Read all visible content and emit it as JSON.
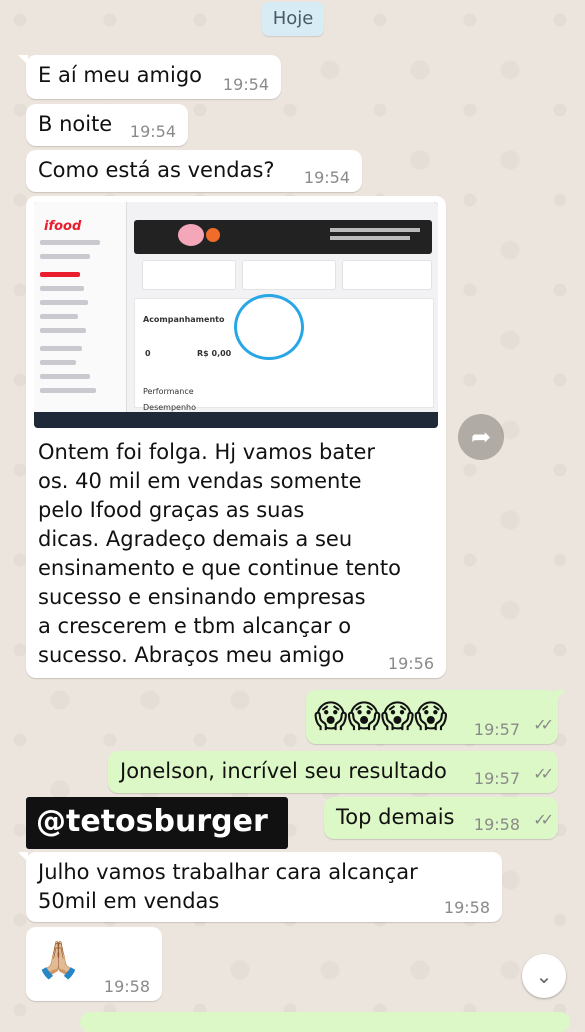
{
  "date_label": "Hoje",
  "messages": [
    {
      "text": "E aí meu amigo",
      "time": "19:54"
    },
    {
      "text": "B noite",
      "time": "19:54"
    },
    {
      "text": "Como está as vendas?",
      "time": "19:54"
    },
    {
      "photo": {
        "brand": "ifood",
        "banner": "Repasse semanal com taxa reduzida ativo!",
        "section": "Acompanhamento",
        "values": [
          "0",
          "R$ 0,00"
        ],
        "rows": [
          "Performance",
          "Desempenho"
        ]
      },
      "caption_lines": [
        "Ontem foi folga. Hj vamos bater",
        "os. 40 mil em vendas somente",
        "pelo Ifood graças as suas",
        "dicas. Agradeço demais a seu",
        "ensinamento e que continue tento",
        "sucesso e ensinando empresas",
        "a crescerem e tbm alcançar o",
        "sucesso. Abraços meu amigo"
      ],
      "time": "19:56"
    },
    {
      "text": "😱😱😱😱",
      "time": "19:57",
      "ticks": "✓✓"
    },
    {
      "text": "Jonelson, incrível seu resultado",
      "time": "19:57",
      "ticks": "✓✓"
    },
    {
      "text": "Top demais",
      "time": "19:58",
      "ticks": "✓✓"
    },
    {
      "lines": [
        "Julho vamos trabalhar cara alcançar",
        "50mil em vendas"
      ],
      "time": "19:58"
    },
    {
      "text": "🙏🏼",
      "time": "19:58"
    }
  ],
  "handle_overlay": "@tetosburger",
  "icons": {
    "forward": "forward-icon",
    "scroll": "chevron-down-icon"
  }
}
